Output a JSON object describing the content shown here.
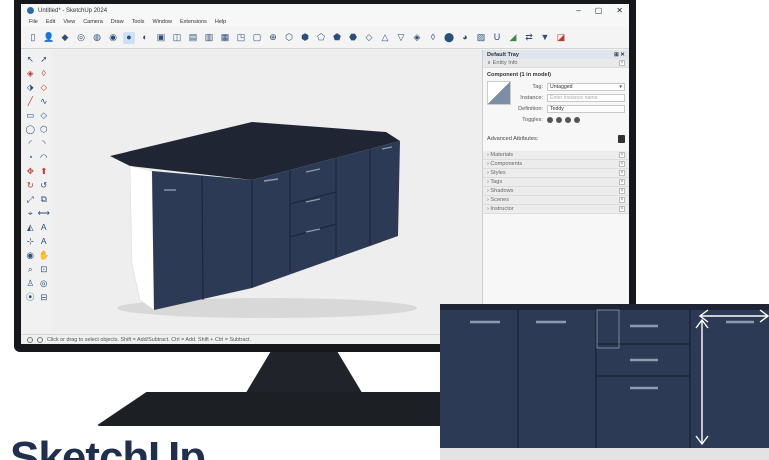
{
  "window": {
    "title": "Untitled* - SketchUp 2024",
    "controls": [
      "–",
      "▢",
      "✕"
    ]
  },
  "menu": [
    "File",
    "Edit",
    "View",
    "Camera",
    "Draw",
    "Tools",
    "Window",
    "Extensions",
    "Help"
  ],
  "toolbar": [
    {
      "name": "new-file-icon",
      "glyph": "▯"
    },
    {
      "name": "account-icon",
      "glyph": "👤"
    },
    {
      "name": "select-icon",
      "glyph": "◆"
    },
    {
      "name": "orbit-icon",
      "glyph": "◎"
    },
    {
      "name": "pan-icon",
      "glyph": "◍"
    },
    {
      "name": "paint-icon",
      "glyph": "◉"
    },
    {
      "name": "style-shaded-icon",
      "glyph": "●",
      "active": true
    },
    {
      "name": "style-xray-icon",
      "glyph": "◐"
    },
    {
      "name": "iso-view-icon",
      "glyph": "▣"
    },
    {
      "name": "top-view-icon",
      "glyph": "◫"
    },
    {
      "name": "front-view-icon",
      "glyph": "▤"
    },
    {
      "name": "right-view-icon",
      "glyph": "▥"
    },
    {
      "name": "back-view-icon",
      "glyph": "▦"
    },
    {
      "name": "left-view-icon",
      "glyph": "◳"
    },
    {
      "name": "bottom-view-icon",
      "glyph": "▢"
    },
    {
      "name": "section-icon",
      "glyph": "⊕"
    },
    {
      "name": "outer-shell-icon",
      "glyph": "⬡"
    },
    {
      "name": "intersect-icon",
      "glyph": "⬢"
    },
    {
      "name": "union-icon",
      "glyph": "⬠"
    },
    {
      "name": "subtract-icon",
      "glyph": "⬟"
    },
    {
      "name": "trim-icon",
      "glyph": "⬣"
    },
    {
      "name": "split-icon",
      "glyph": "◇"
    },
    {
      "name": "sandbox-icon",
      "glyph": "△"
    },
    {
      "name": "terrain-icon",
      "glyph": "▽"
    },
    {
      "name": "stamp-icon",
      "glyph": "◈"
    },
    {
      "name": "drape-icon",
      "glyph": "◊"
    },
    {
      "name": "solid-tools-icon",
      "glyph": "⬤"
    },
    {
      "name": "warehouse-icon",
      "glyph": "◕"
    },
    {
      "name": "extension-icon",
      "glyph": "▨"
    },
    {
      "name": "ruby-icon",
      "glyph": "U"
    },
    {
      "name": "layout-icon",
      "glyph": "◢",
      "color": "green"
    },
    {
      "name": "send-icon",
      "glyph": "⇄"
    },
    {
      "name": "bookmark-icon",
      "glyph": "▼"
    },
    {
      "name": "ruby-console-icon",
      "glyph": "◪",
      "color": "red"
    }
  ],
  "palette": [
    {
      "name": "select-tool-icon",
      "glyph": "↖"
    },
    {
      "name": "lasso-tool-icon",
      "glyph": "➚"
    },
    {
      "name": "paint-bucket-icon",
      "glyph": "◈",
      "color": "red"
    },
    {
      "name": "eraser-icon",
      "glyph": "◊",
      "color": "red"
    },
    {
      "name": "tag-tool-icon",
      "glyph": "⬗"
    },
    {
      "name": "eraser-alt-icon",
      "glyph": "◇",
      "color": "red"
    },
    {
      "name": "line-tool-icon",
      "glyph": "╱",
      "color": "red"
    },
    {
      "name": "freehand-icon",
      "glyph": "∿"
    },
    {
      "name": "rectangle-tool-icon",
      "glyph": "▭"
    },
    {
      "name": "rotated-rect-icon",
      "glyph": "◇"
    },
    {
      "name": "circle-tool-icon",
      "glyph": "◯"
    },
    {
      "name": "polygon-tool-icon",
      "glyph": "⬡"
    },
    {
      "name": "arc-tool-icon",
      "glyph": "◜"
    },
    {
      "name": "arc2-tool-icon",
      "glyph": "◝"
    },
    {
      "name": "pie-tool-icon",
      "glyph": "◔"
    },
    {
      "name": "arc3-tool-icon",
      "glyph": "◠"
    },
    {
      "name": "move-tool-icon",
      "glyph": "✥",
      "color": "red"
    },
    {
      "name": "pushpull-tool-icon",
      "glyph": "⬆",
      "color": "red"
    },
    {
      "name": "rotate-tool-icon",
      "glyph": "↻",
      "color": "red"
    },
    {
      "name": "followme-tool-icon",
      "glyph": "↺"
    },
    {
      "name": "scale-tool-icon",
      "glyph": "⤢"
    },
    {
      "name": "offset-tool-icon",
      "glyph": "⧉"
    },
    {
      "name": "tape-tool-icon",
      "glyph": "⌖"
    },
    {
      "name": "dimension-tool-icon",
      "glyph": "⟷"
    },
    {
      "name": "protractor-icon",
      "glyph": "◭"
    },
    {
      "name": "text-tool-icon",
      "glyph": "A"
    },
    {
      "name": "axes-tool-icon",
      "glyph": "⊹"
    },
    {
      "name": "3dtext-tool-icon",
      "glyph": "A"
    },
    {
      "name": "orbit-tool-icon",
      "glyph": "◉"
    },
    {
      "name": "pan-tool-icon",
      "glyph": "✋"
    },
    {
      "name": "zoom-tool-icon",
      "glyph": "⌕"
    },
    {
      "name": "zoom-window-icon",
      "glyph": "⊡"
    },
    {
      "name": "walk-tool-icon",
      "glyph": "♙"
    },
    {
      "name": "look-tool-icon",
      "glyph": "◎"
    },
    {
      "name": "position-camera-icon",
      "glyph": "⦿"
    },
    {
      "name": "section-plane-icon",
      "glyph": "⊟"
    }
  ],
  "status": {
    "text": "Click or drag to select objects. Shift = Add/Subtract. Ctrl = Add. Shift + Ctrl = Subtract."
  },
  "tray": {
    "title": "Default Tray",
    "entity_info": "Entity Info",
    "component_title": "Component (1 in model)",
    "tag_label": "Tag:",
    "tag_value": "Untagged",
    "instance_label": "Instance:",
    "instance_placeholder": "Enter instance name",
    "definition_label": "Definition:",
    "definition_value": "Teddy",
    "toggles_label": "Toggles:",
    "advanced_label": "Advanced Attributes:",
    "panels": [
      "Materials",
      "Components",
      "Styles",
      "Tags",
      "Shadows",
      "Scenes",
      "Instructor"
    ]
  },
  "colors": {
    "cabinet_front": "#2d3a55",
    "cabinet_top": "#1f2533",
    "cabinet_side": "#ffffff",
    "accent": "#2a4f7a"
  },
  "heading": {
    "text": "SketchUp"
  }
}
